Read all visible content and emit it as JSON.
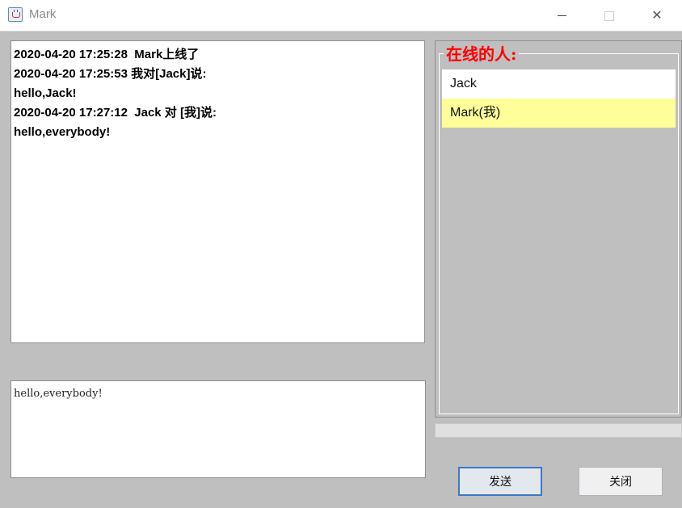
{
  "window": {
    "title": "Mark",
    "minimize_glyph": "—",
    "maximize_glyph": "□",
    "close_glyph": "✕"
  },
  "chat": {
    "messages": [
      "2020-04-20 17:25:28  Mark上线了",
      "2020-04-20 17:25:53 我对[Jack]说:",
      "hello,Jack!",
      "2020-04-20 17:27:12  Jack 对 [我]说:",
      "hello,everybody!"
    ]
  },
  "input": {
    "value": "hello,everybody!"
  },
  "online": {
    "title": "在线的人:",
    "users": [
      {
        "name": "Jack",
        "selected": false
      },
      {
        "name": "Mark(我)",
        "selected": true
      }
    ]
  },
  "buttons": {
    "send_label": "发送",
    "close_label": "关闭"
  },
  "colors": {
    "background": "#bfbfbf",
    "online_title": "#ff0000",
    "selected_user": "#ffff99",
    "send_border": "#3d78c6"
  },
  "icons": {
    "app": "java-cup-icon",
    "minimize": "minimize-icon",
    "maximize": "maximize-icon",
    "close": "close-icon"
  }
}
